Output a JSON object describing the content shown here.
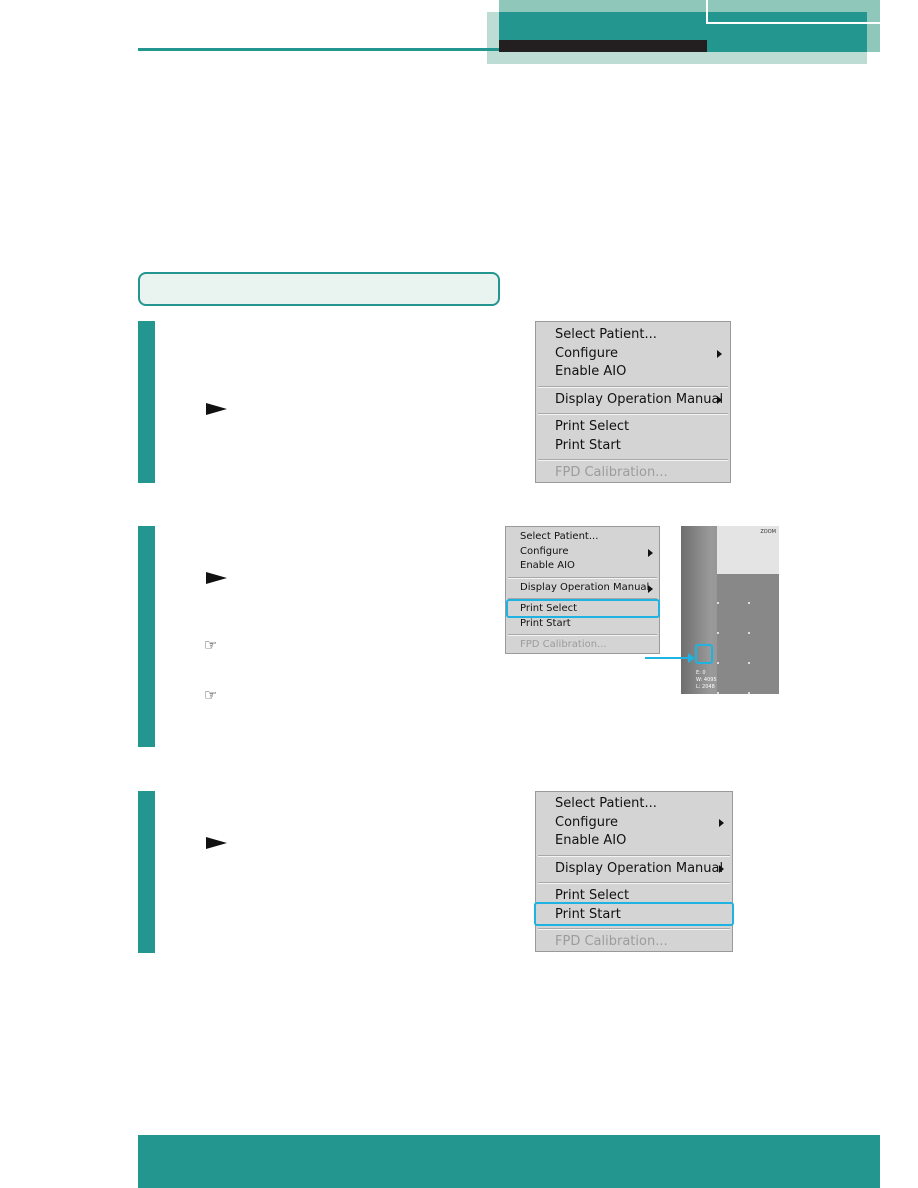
{
  "colors": {
    "accent": "#22968f",
    "light": "#8fc7bb",
    "pale": "#bcdcd4",
    "highlight": "#1eb3e0"
  },
  "menu_full": {
    "items": [
      {
        "label": "Select Patient...",
        "submenu": false,
        "disabled": false
      },
      {
        "label": "Configure",
        "submenu": true,
        "disabled": false
      },
      {
        "label": "Enable AIO",
        "submenu": false,
        "disabled": false
      },
      {
        "label": "Display Operation Manual",
        "submenu": true,
        "disabled": false
      },
      {
        "label": "Print Select",
        "submenu": false,
        "disabled": false
      },
      {
        "label": "Print Start",
        "submenu": false,
        "disabled": false
      },
      {
        "label": "FPD Calibration...",
        "submenu": false,
        "disabled": true
      }
    ]
  },
  "step2_image": {
    "readout": [
      "E:   0",
      "W: 4095",
      "L: 2048"
    ],
    "zoom_label": "ZOOM"
  },
  "icons": {
    "step_arrow": "triangle-right",
    "reference": "pointing-hand"
  }
}
